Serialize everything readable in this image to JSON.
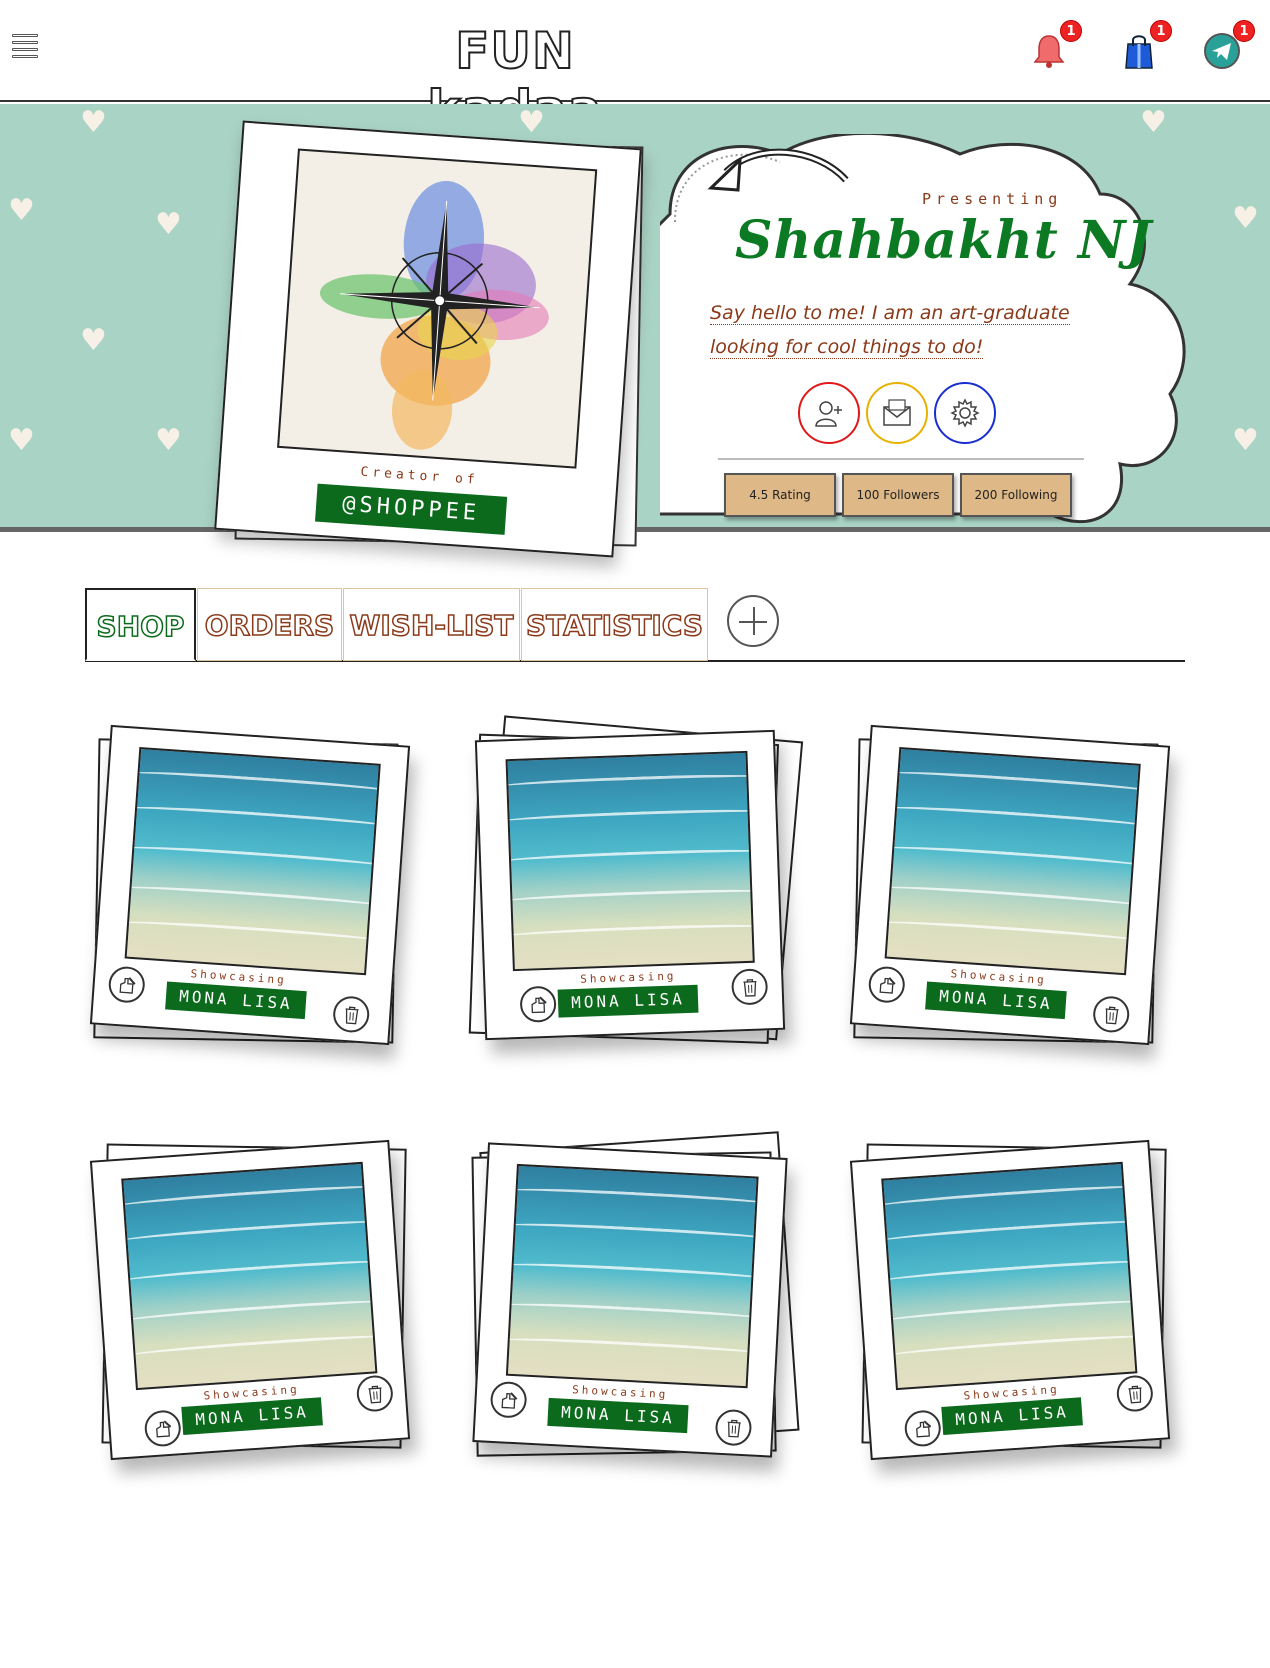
{
  "header": {
    "brand": "FUN kadaa",
    "menu_icon": "hamburger-icon",
    "icons": [
      {
        "name": "bell-icon",
        "badge": "1"
      },
      {
        "name": "shopping-bag-icon",
        "badge": "1"
      },
      {
        "name": "telegram-icon",
        "badge": "1"
      }
    ]
  },
  "profile": {
    "creator_label": "Creator of",
    "shop_handle": "@SHOPPEE",
    "presenting": "Presenting",
    "name": "Shahbakht NJ",
    "bio_line1": "Say hello to me! I am an art-graduate",
    "bio_line2": "looking for cool things to do!",
    "actions": [
      "add-user-icon",
      "mail-icon",
      "gear-icon"
    ],
    "stats": {
      "rating": "4.5 Rating",
      "followers": "100 Followers",
      "following": "200 Following"
    }
  },
  "tabs": {
    "items": [
      "SHOP",
      "ORDERS",
      "WISH-LIST",
      "STATISTICS"
    ],
    "active": "SHOP",
    "add_icon": "plus-icon"
  },
  "cards": [
    {
      "label": "Showcasing",
      "title": "MONA LISA"
    },
    {
      "label": "Showcasing",
      "title": "MONA LISA"
    },
    {
      "label": "Showcasing",
      "title": "MONA LISA"
    },
    {
      "label": "Showcasing",
      "title": "MONA LISA"
    },
    {
      "label": "Showcasing",
      "title": "MONA LISA"
    },
    {
      "label": "Showcasing",
      "title": "MONA LISA"
    }
  ],
  "colors": {
    "accent_green": "#0b6a1c",
    "accent_brown": "#8a3a1a",
    "banner_bg": "#a9d3c4",
    "stat_bg": "#deb887"
  }
}
